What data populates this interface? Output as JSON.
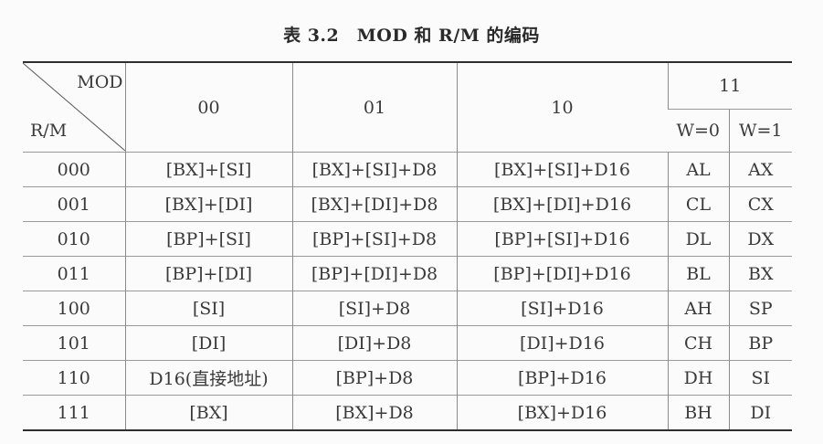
{
  "caption": "表 3.2　MOD 和 R/M 的编码",
  "table": {
    "corner_mod": "MOD",
    "corner_rm": "R/M",
    "mod_headers": [
      "00",
      "01",
      "10",
      "11"
    ],
    "w_headers": [
      "W=0",
      "W=1"
    ],
    "rows": [
      {
        "rm": "000",
        "m00": "[BX]+[SI]",
        "m01": "[BX]+[SI]+D8",
        "m10": "[BX]+[SI]+D16",
        "w0": "AL",
        "w1": "AX"
      },
      {
        "rm": "001",
        "m00": "[BX]+[DI]",
        "m01": "[BX]+[DI]+D8",
        "m10": "[BX]+[DI]+D16",
        "w0": "CL",
        "w1": "CX"
      },
      {
        "rm": "010",
        "m00": "[BP]+[SI]",
        "m01": "[BP]+[SI]+D8",
        "m10": "[BP]+[SI]+D16",
        "w0": "DL",
        "w1": "DX"
      },
      {
        "rm": "011",
        "m00": "[BP]+[DI]",
        "m01": "[BP]+[DI]+D8",
        "m10": "[BP]+[DI]+D16",
        "w0": "BL",
        "w1": "BX"
      },
      {
        "rm": "100",
        "m00": "[SI]",
        "m01": "[SI]+D8",
        "m10": "[SI]+D16",
        "w0": "AH",
        "w1": "SP"
      },
      {
        "rm": "101",
        "m00": "[DI]",
        "m01": "[DI]+D8",
        "m10": "[DI]+D16",
        "w0": "CH",
        "w1": "BP"
      },
      {
        "rm": "110",
        "m00": "D16(直接地址)",
        "m01": "[BP]+D8",
        "m10": "[BP]+D16",
        "w0": "DH",
        "w1": "SI"
      },
      {
        "rm": "111",
        "m00": "[BX]",
        "m01": "[BX]+D8",
        "m10": "[BX]+D16",
        "w0": "BH",
        "w1": "DI"
      }
    ]
  }
}
